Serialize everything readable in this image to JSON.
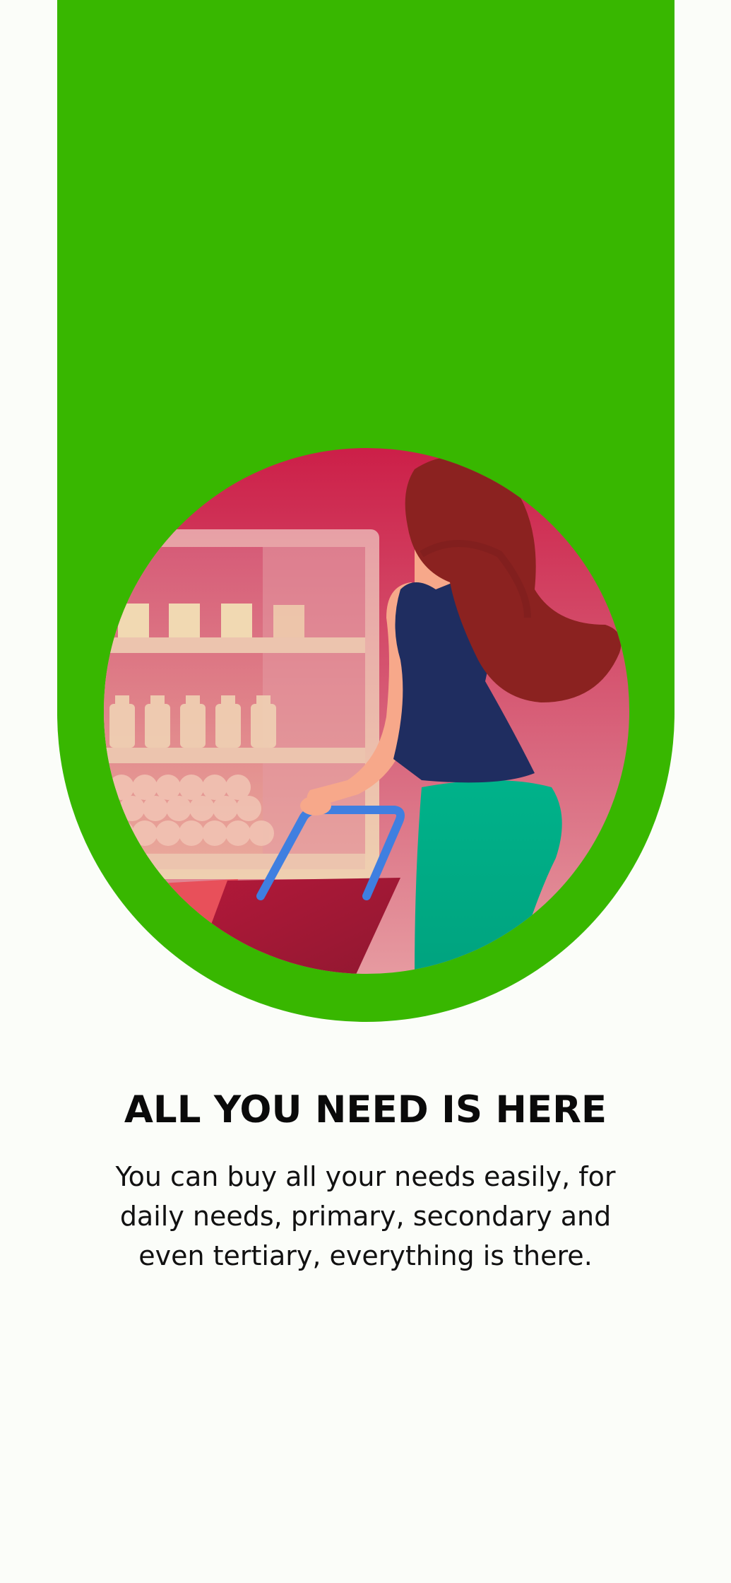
{
  "colors": {
    "background": "#fbfdf9",
    "hero_green": "#38b700",
    "text": "#0a0a0a"
  },
  "illustration": {
    "icon": "shopping-woman-illustration"
  },
  "onboarding": {
    "title": "ALL YOU NEED IS HERE",
    "description": "You can buy all your needs easily, for daily needs, primary, secondary and even tertiary, everything is there."
  }
}
